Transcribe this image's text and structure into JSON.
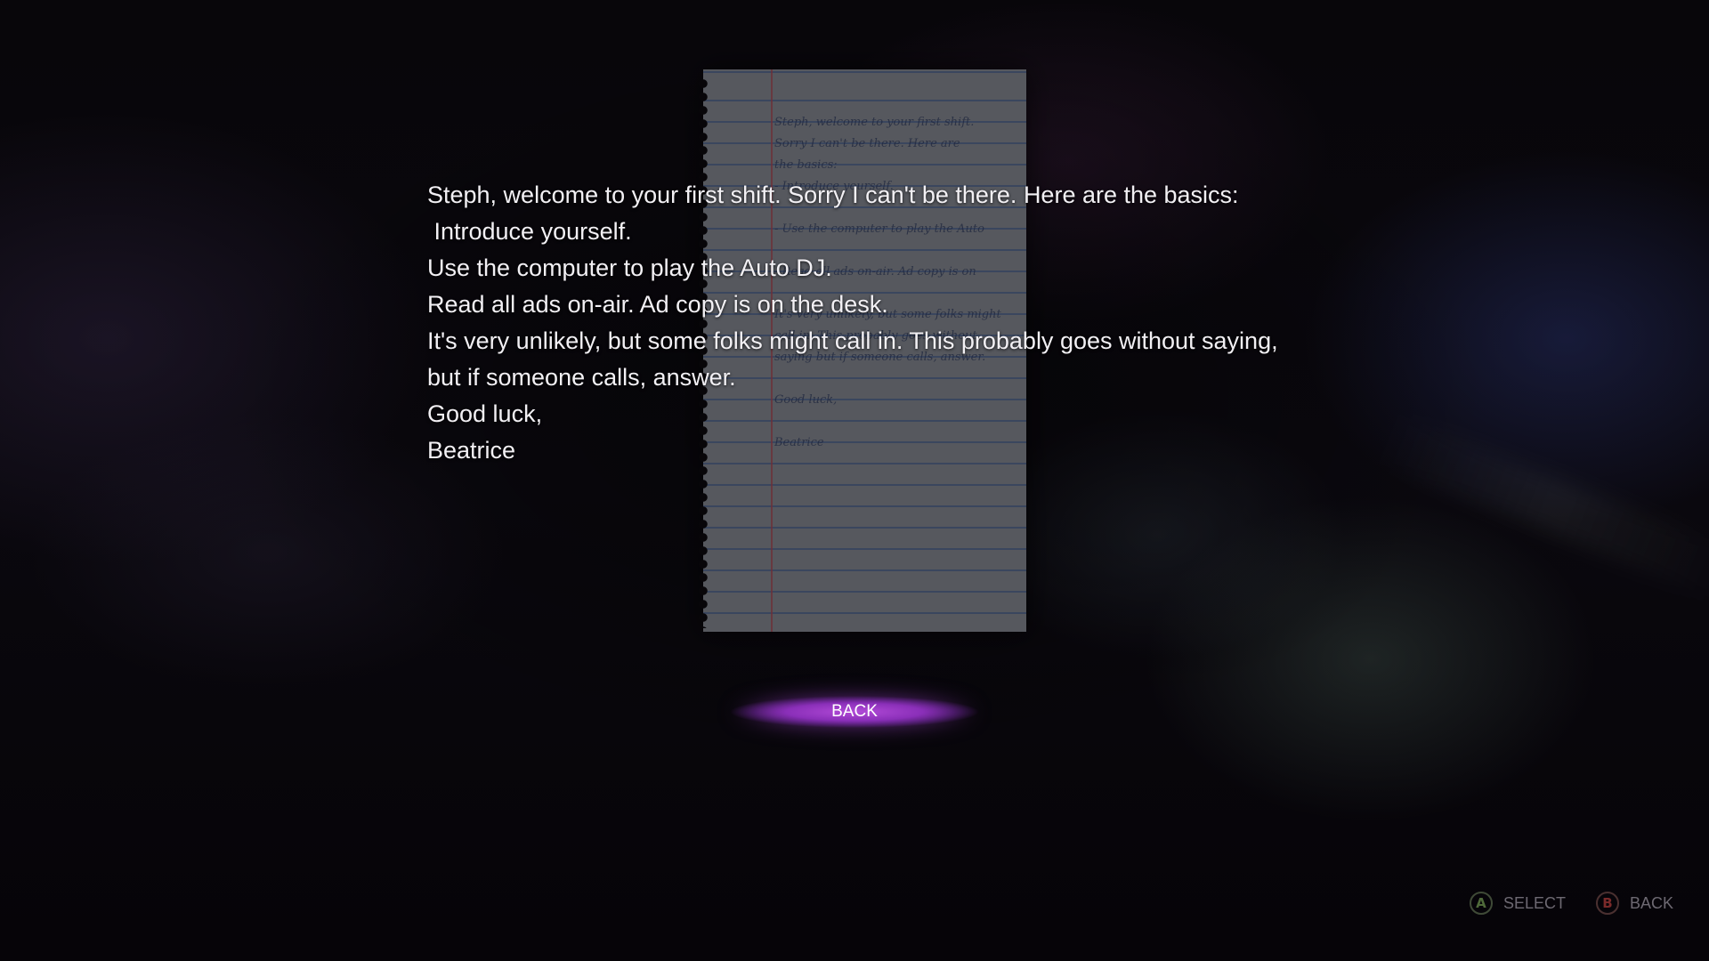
{
  "letter": {
    "lines": [
      "Steph, welcome to your first shift. Sorry I can't be there. Here are the basics:",
      " Introduce yourself.",
      "Use the computer to play the Auto DJ.",
      "Read all ads on-air. Ad copy is on the desk.",
      "It's very unlikely, but some folks might call in. This probably goes without saying,",
      "but if someone calls, answer.",
      "Good luck,",
      "Beatrice"
    ]
  },
  "note": {
    "handwriting": "Steph, welcome to your first shift.\nSorry I can't be there. Here are\nthe basics:\n- Introduce yourself.\n\n- Use the computer to play the Auto\n\n- Read all ads on-air. Ad copy is on\n\nIt's very unlikely, but some folks might\ncall in. This probably goes without\nsaying but if someone calls, answer.\n\nGood luck,\n\nBeatrice"
  },
  "menu": {
    "back_label": "BACK"
  },
  "hints": [
    {
      "glyph": "A",
      "label": "SELECT",
      "icon": "a-button-icon",
      "color": "#4f6a3a"
    },
    {
      "glyph": "B",
      "label": "BACK",
      "icon": "b-button-icon",
      "color": "#7a2a2a"
    }
  ],
  "colors": {
    "accent": "#a23fd0",
    "text": "#f2f0f4",
    "hint_text": "#6d6972"
  }
}
